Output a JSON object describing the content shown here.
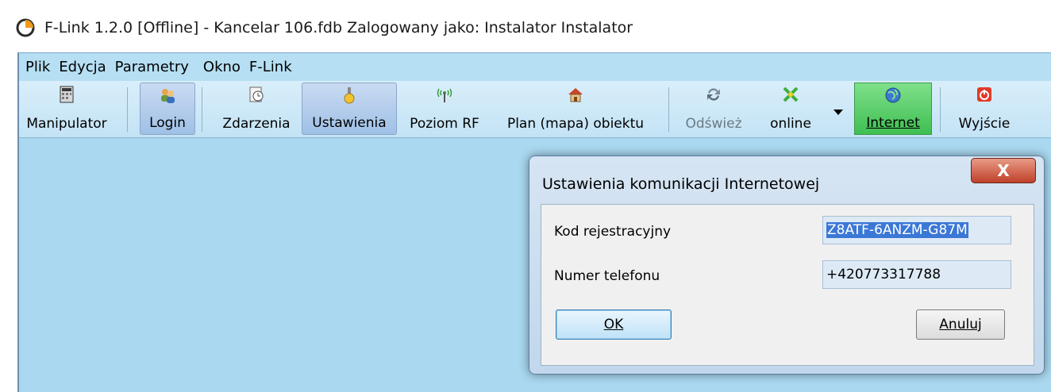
{
  "window": {
    "title": "F-Link 1.2.0 [Offline] - Kancelar 106.fdb Zalogowany jako: Instalator Instalator"
  },
  "menu": [
    "Plik",
    "Edycja",
    "Parametry",
    "Okno",
    "F-Link"
  ],
  "toolbar": {
    "manipulator": "Manipulator",
    "login": "Login",
    "zdarzenia": "Zdarzenia",
    "ustawienia": "Ustawienia",
    "poziom_rf": "Poziom RF",
    "plan": "Plan (mapa) obiektu",
    "odswiez": "Odśwież",
    "online": "online",
    "internet": "Internet",
    "wyjscie": "Wyjście"
  },
  "dialog": {
    "title": "Ustawienia komunikacji Internetowej",
    "close": "X",
    "kod_label": "Kod rejestracyjny",
    "kod_value": "Z8ATF-6ANZM-G87M",
    "tel_label": "Numer telefonu",
    "tel_value": "+420773317788",
    "ok": "OK",
    "cancel": "Anuluj"
  },
  "colors": {
    "client_bg": "#a9d8f0",
    "internet_active": "#3fbf52",
    "close_button": "#c0412a"
  }
}
